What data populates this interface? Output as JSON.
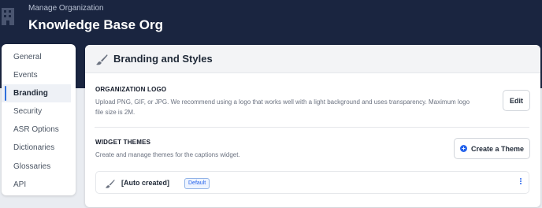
{
  "header": {
    "subtitle": "Manage Organization",
    "title": "Knowledge Base Org"
  },
  "sidebar": {
    "items": [
      {
        "label": "General",
        "active": false
      },
      {
        "label": "Events",
        "active": false
      },
      {
        "label": "Branding",
        "active": true
      },
      {
        "label": "Security",
        "active": false
      },
      {
        "label": "ASR Options",
        "active": false
      },
      {
        "label": "Dictionaries",
        "active": false
      },
      {
        "label": "Glossaries",
        "active": false
      },
      {
        "label": "API",
        "active": false
      }
    ]
  },
  "main": {
    "title": "Branding and Styles",
    "logo_section": {
      "label": "ORGANIZATION LOGO",
      "description": "Upload PNG, GIF, or JPG. We recommend using a logo that works well with a light background and uses transparency. Maximum logo file size is 2M.",
      "edit_label": "Edit"
    },
    "themes_section": {
      "label": "WIDGET THEMES",
      "description": "Create and manage themes for the captions widget.",
      "create_label": "Create a Theme",
      "themes": [
        {
          "name": "[Auto created]",
          "badge": "Default"
        }
      ]
    }
  },
  "colors": {
    "header_bg": "#1a2540",
    "accent": "#2563eb",
    "page_bg": "#e9ecf1"
  }
}
